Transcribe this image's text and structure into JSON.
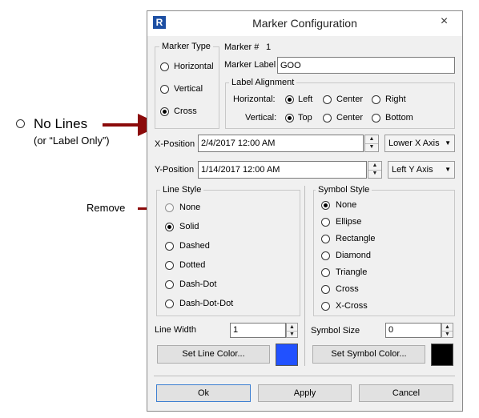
{
  "window": {
    "title": "Marker Configuration",
    "app_icon": "R",
    "close_icon": "×"
  },
  "marker_type": {
    "group_label": "Marker Type",
    "options": [
      "Horizontal",
      "Vertical",
      "Cross"
    ],
    "selected": "Cross"
  },
  "marker_number": {
    "label": "Marker #",
    "value": "1"
  },
  "marker_label": {
    "label": "Marker Label",
    "value": "GOO"
  },
  "label_alignment": {
    "group_label": "Label Alignment",
    "horizontal_label": "Horizontal:",
    "horizontal_options": [
      "Left",
      "Center",
      "Right"
    ],
    "horizontal_selected": "Left",
    "vertical_label": "Vertical:",
    "vertical_options": [
      "Top",
      "Center",
      "Bottom"
    ],
    "vertical_selected": "Top"
  },
  "x_position": {
    "label": "X-Position",
    "value": "2/4/2017 12:00 AM",
    "axis": "Lower X Axis"
  },
  "y_position": {
    "label": "Y-Position",
    "value": "1/14/2017 12:00 AM",
    "axis": "Left Y Axis"
  },
  "line_style": {
    "group_label": "Line Style",
    "options": [
      "None",
      "Solid",
      "Dashed",
      "Dotted",
      "Dash-Dot",
      "Dash-Dot-Dot"
    ],
    "selected": "Solid",
    "width_label": "Line Width",
    "width_value": "1",
    "color_button": "Set Line Color...",
    "color": "#2151ff"
  },
  "symbol_style": {
    "group_label": "Symbol Style",
    "options": [
      "None",
      "Ellipse",
      "Rectangle",
      "Diamond",
      "Triangle",
      "Cross",
      "X-Cross"
    ],
    "selected": "None",
    "size_label": "Symbol Size",
    "size_value": "0",
    "color_button": "Set Symbol Color...",
    "color": "#000000"
  },
  "buttons": {
    "ok": "Ok",
    "apply": "Apply",
    "cancel": "Cancel"
  },
  "annotations": {
    "no_lines": "No Lines",
    "no_lines_sub": "(or “Label Only”)",
    "remove": "Remove",
    "arrow_color": "#8b0a0a"
  },
  "spin_icons": {
    "up": "▲",
    "down": "▼"
  },
  "dropdown_icon": "▼"
}
